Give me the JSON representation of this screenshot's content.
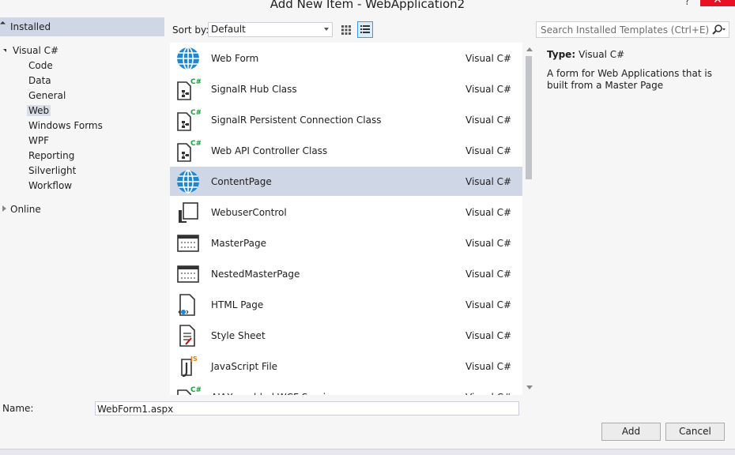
{
  "window": {
    "title": "Add New Item - WebApplication2",
    "help_label": "?",
    "close_label": "✕"
  },
  "tree": {
    "header": "Installed",
    "root": "Visual C#",
    "children": [
      "Code",
      "Data",
      "General",
      "Web",
      "Windows Forms",
      "WPF",
      "Reporting",
      "Silverlight",
      "Workflow"
    ],
    "selected": "Web",
    "online": "Online"
  },
  "toolbar": {
    "sort_label": "Sort by:",
    "sort_value": "Default",
    "search_placeholder": "Search Installed Templates (Ctrl+E)"
  },
  "items": [
    {
      "name": "Web Form",
      "lang": "Visual C#",
      "icon": "globe-icon"
    },
    {
      "name": "SignalR Hub Class",
      "lang": "Visual C#",
      "icon": "csharp-class-icon"
    },
    {
      "name": "SignalR Persistent Connection Class",
      "lang": "Visual C#",
      "icon": "csharp-class-icon"
    },
    {
      "name": "Web API Controller Class",
      "lang": "Visual C#",
      "icon": "csharp-class-icon"
    },
    {
      "name": "ContentPage",
      "lang": "Visual C#",
      "icon": "globe-icon",
      "selected": true
    },
    {
      "name": "WebuserControl",
      "lang": "Visual C#",
      "icon": "user-control-icon"
    },
    {
      "name": "MasterPage",
      "lang": "Visual C#",
      "icon": "master-page-icon"
    },
    {
      "name": "NestedMasterPage",
      "lang": "Visual C#",
      "icon": "master-page-icon"
    },
    {
      "name": "HTML Page",
      "lang": "Visual C#",
      "icon": "html-page-icon"
    },
    {
      "name": "Style Sheet",
      "lang": "Visual C#",
      "icon": "stylesheet-icon"
    },
    {
      "name": "JavaScript File",
      "lang": "Visual C#",
      "icon": "javascript-file-icon"
    },
    {
      "name": "AJAX-enabled WCF Service",
      "lang": "Visual C#",
      "icon": "csharp-class-icon"
    }
  ],
  "details": {
    "type_label": "Type:",
    "type_value": "Visual C#",
    "description": "A form for Web Applications that is built from a Master Page"
  },
  "footer": {
    "name_label": "Name:",
    "name_value": "WebForm1.aspx",
    "add_label": "Add",
    "cancel_label": "Cancel"
  },
  "colors": {
    "selection": "#cfd6e5",
    "accent_green": "#1e9e3c",
    "globe_blue": "#1e88d2"
  }
}
